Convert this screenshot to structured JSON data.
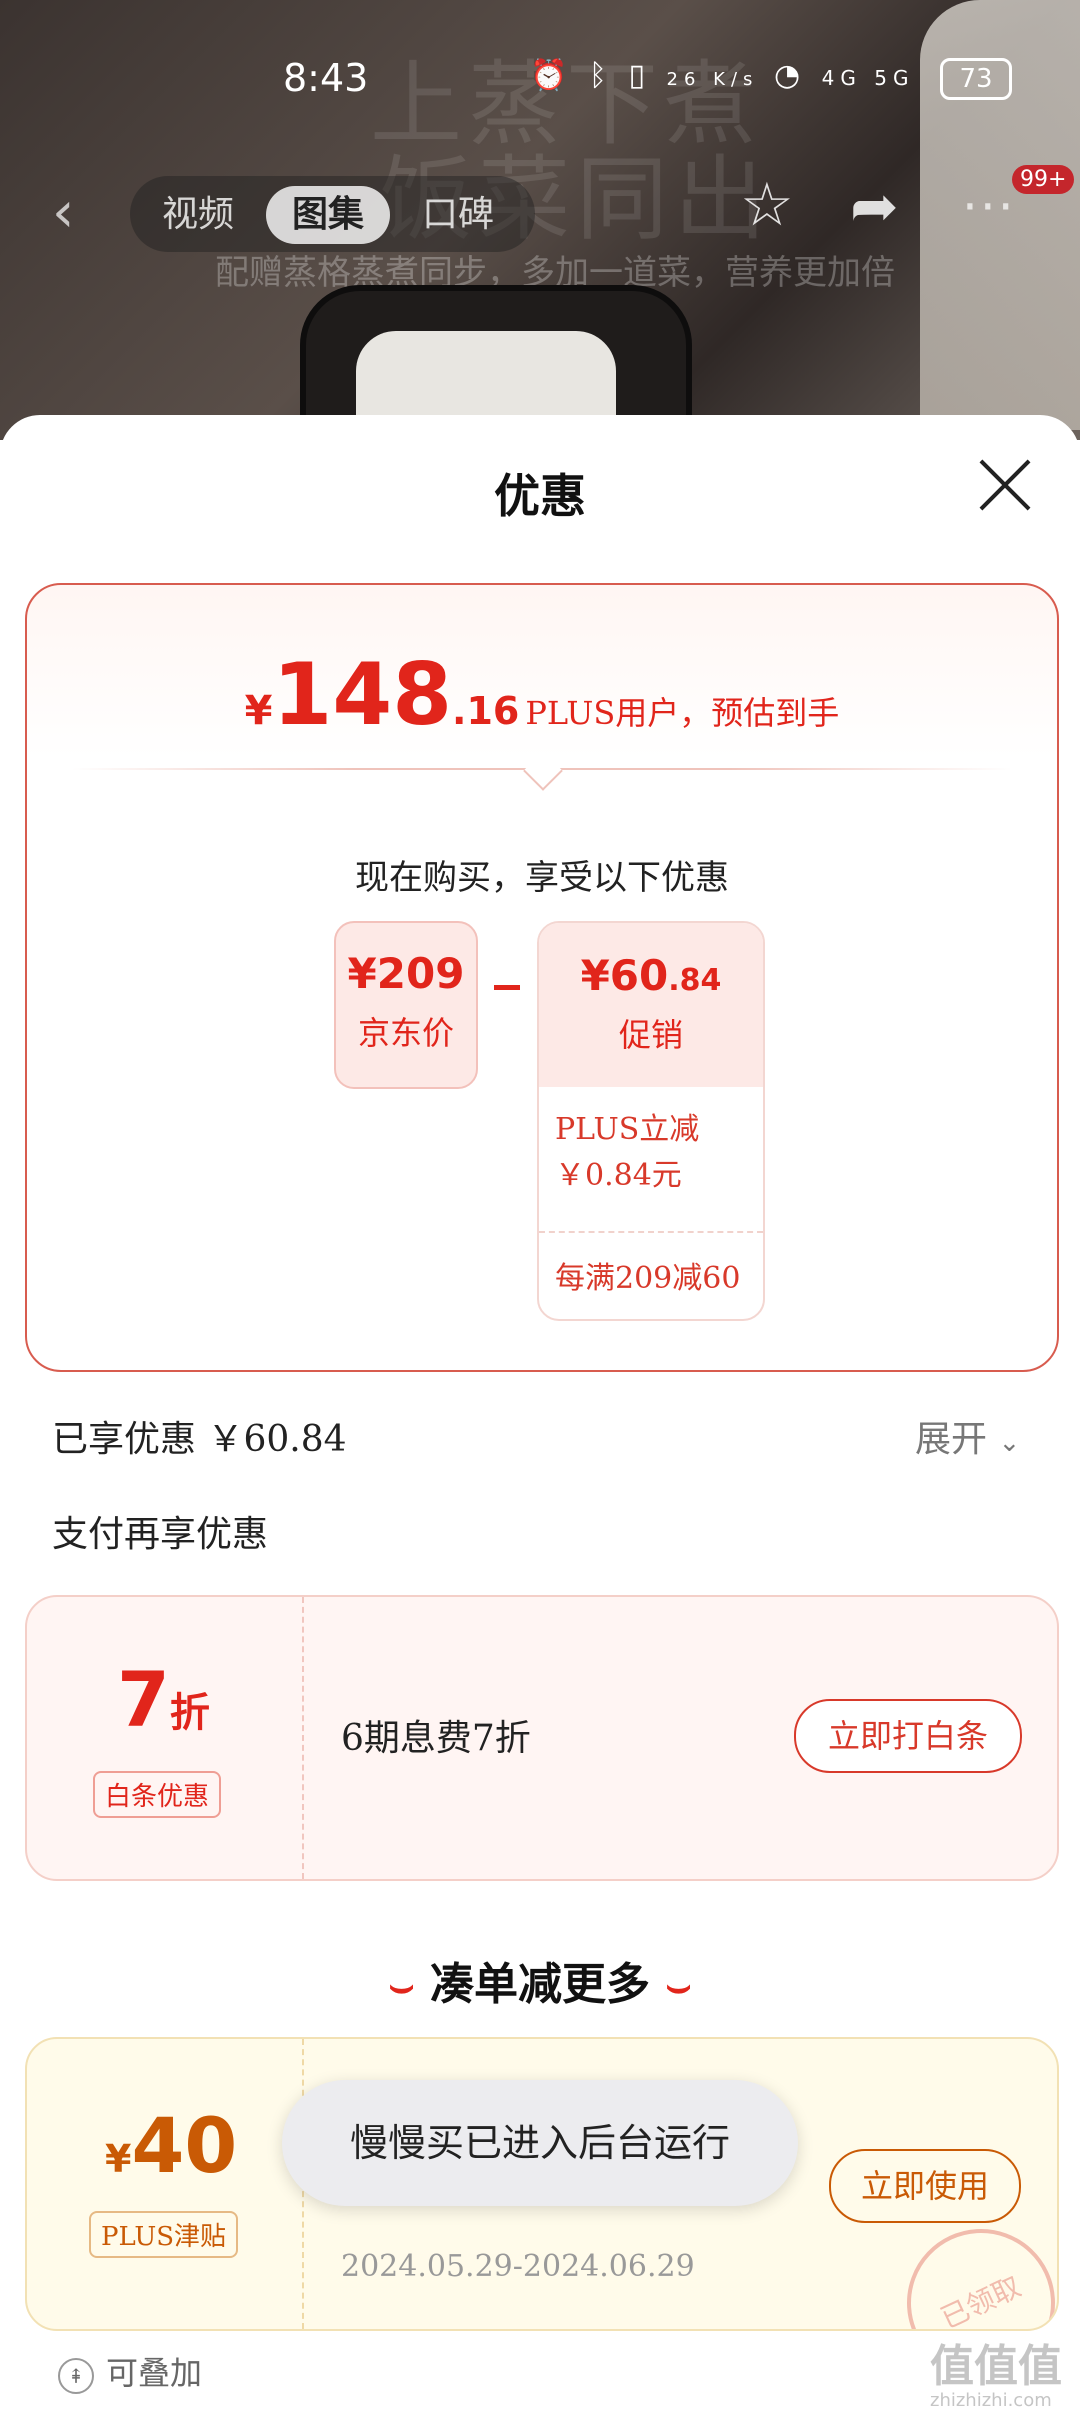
{
  "status_bar": {
    "time": "8:43",
    "net_speed": "26 K/s",
    "signal": "4G 5G",
    "battery": "73"
  },
  "hero": {
    "line1": "上蒸下煮",
    "line2": "饭菜同出",
    "line3": "配赠蒸格蒸煮同步，多加一道菜，营养更加倍"
  },
  "nav": {
    "tabs": [
      {
        "label": "视频"
      },
      {
        "label": "图集"
      },
      {
        "label": "口碑"
      }
    ],
    "badge": "99+"
  },
  "sheet": {
    "title": "优惠",
    "price": {
      "currency": "¥",
      "integer": "148",
      "decimal": ".16",
      "note": "PLUS用户，预估到手"
    },
    "buy_now": "现在购买，享受以下优惠",
    "jd_price": {
      "value": "¥209",
      "label": "京东价"
    },
    "promo": {
      "value_int": "¥60",
      "value_dec": ".84",
      "label": "促销",
      "detail1_line1": "PLUS立减",
      "detail1_line2": "￥0.84元",
      "detail2": "每满209减60"
    },
    "enjoyed": "已享优惠 ￥60.84",
    "expand": "展开",
    "pay_more": "支付再享优惠",
    "baitiao": {
      "discount_num": "7",
      "discount_unit": "折",
      "tag": "白条优惠",
      "desc": "6期息费7折",
      "button": "立即打白条"
    },
    "more_title": "凑单减更多",
    "coupon": {
      "currency": "¥",
      "amount": "40",
      "tag": "PLUS津贴",
      "date": "2024.05.29-2024.06.29",
      "button": "立即使用",
      "stamp": "已领取"
    },
    "stackable": "可叠加"
  },
  "toast": "慢慢买已进入后台运行",
  "watermark": {
    "main": "值值值",
    "sub": "zhizhizhi.com"
  }
}
